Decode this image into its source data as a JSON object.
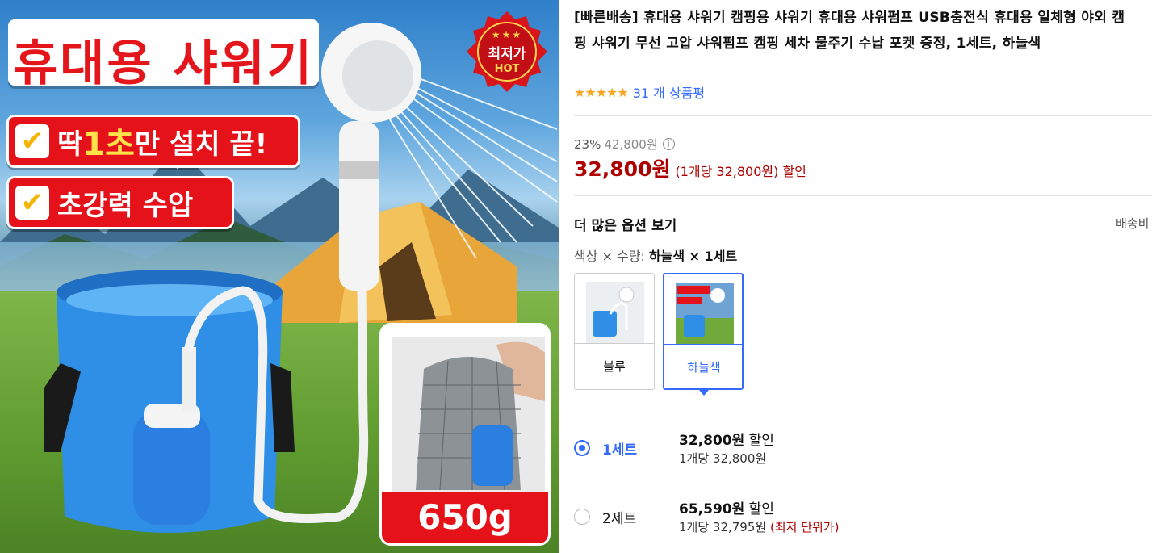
{
  "hero": {
    "title": "휴대용 샤워기",
    "badge_main": "최저가",
    "badge_sub": "HOT",
    "badge_stars": "★★★",
    "feature1_pre": "딱",
    "feature1_big": "1초",
    "feature1_post": "만 설치 끝!",
    "feature2": "초강력 수압",
    "weight": "650g"
  },
  "product": {
    "title": "[빠른배송] 휴대용 샤워기 캠핑용 샤워기 휴대용 샤워펌프 USB충전식 휴대용 일체형 야외 캠핑 샤워기 무선 고압 샤워펌프 캠핑 세차 물주기 수납 포켓 증정, 1세트, 하늘색",
    "rating_stars": "★★★★★",
    "rating_value": 5,
    "review_count_text": "31 개 상품평"
  },
  "price": {
    "discount_rate": "23%",
    "original_price": "42,800원",
    "sale_price": "32,800원",
    "unit_note": "(1개당 32,800원) 할인"
  },
  "options": {
    "heading": "더 많은 옵션 보기",
    "shipping_cut": "배송비",
    "selection_label": "색상 × 수량:",
    "selection_value": "하늘색 × 1세트",
    "colors": [
      {
        "label": "블루",
        "selected": false
      },
      {
        "label": "하늘색",
        "selected": true
      }
    ]
  },
  "quantities": [
    {
      "label": "1세트",
      "price": "32,800원",
      "suffix": "할인",
      "unit": "1개당 32,800원",
      "best": "",
      "selected": true
    },
    {
      "label": "2세트",
      "price": "65,590원",
      "suffix": "할인",
      "unit": "1개당 32,795원",
      "best": "(최저 단위가)",
      "selected": false
    }
  ],
  "colors": {
    "accent": "#346aff",
    "price_red": "#ae0000",
    "banner_red": "#e6121a",
    "star": "#f5a623"
  }
}
